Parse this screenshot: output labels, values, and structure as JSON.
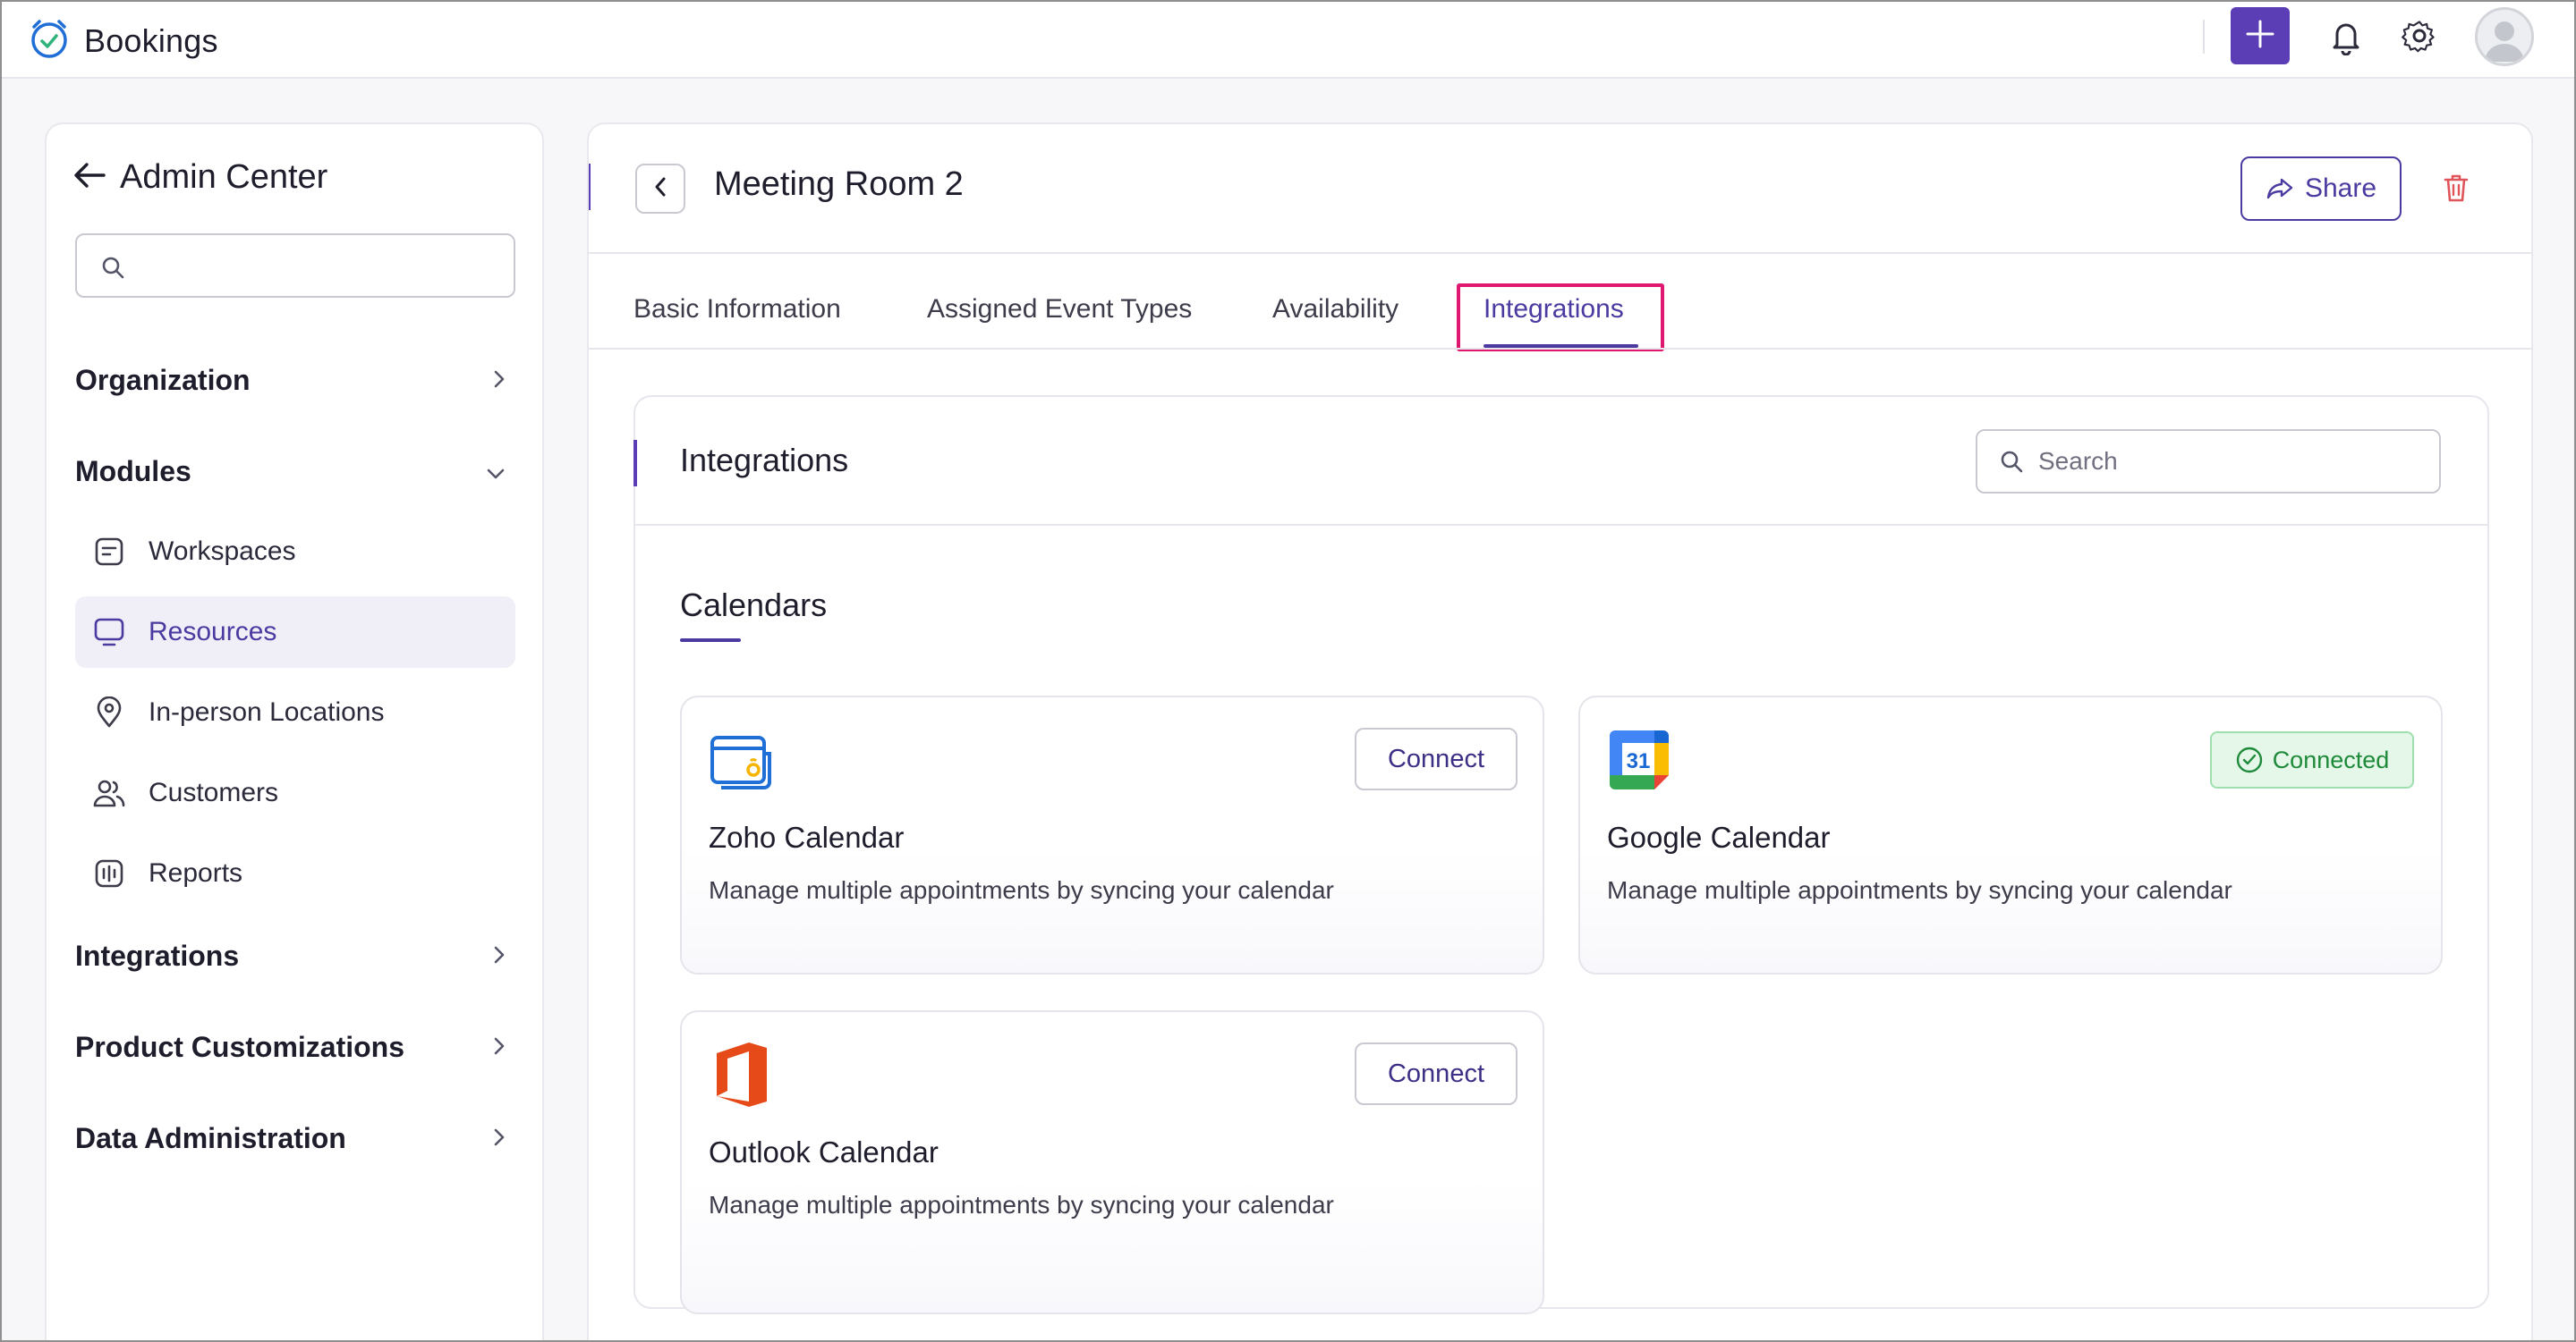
{
  "app": {
    "title": "Bookings",
    "icons": [
      "bookings-logo-icon",
      "plus-icon",
      "bell-icon",
      "gear-icon",
      "avatar"
    ]
  },
  "sidebar": {
    "title": "Admin Center",
    "search_placeholder": "",
    "sections": [
      {
        "label": "Organization",
        "state": "collapsed"
      },
      {
        "label": "Modules",
        "state": "expanded"
      },
      {
        "label": "Integrations",
        "state": "collapsed"
      },
      {
        "label": "Product Customizations",
        "state": "collapsed"
      },
      {
        "label": "Data Administration",
        "state": "collapsed"
      }
    ],
    "module_items": [
      {
        "label": "Workspaces",
        "icon": "workspace-icon"
      },
      {
        "label": "Resources",
        "icon": "monitor-icon",
        "active": true
      },
      {
        "label": "In-person Locations",
        "icon": "location-pin-icon"
      },
      {
        "label": "Customers",
        "icon": "users-icon"
      },
      {
        "label": "Reports",
        "icon": "reports-icon"
      }
    ]
  },
  "main": {
    "title": "Meeting Room 2",
    "share_label": "Share",
    "tabs": [
      {
        "label": "Basic Information"
      },
      {
        "label": "Assigned Event Types"
      },
      {
        "label": "Availability"
      },
      {
        "label": "Integrations",
        "active": true
      }
    ],
    "integrations": {
      "title": "Integrations",
      "search_placeholder": "Search",
      "category": "Calendars",
      "cards": [
        {
          "name": "Zoho Calendar",
          "description": "Manage multiple appointments by syncing your calendar",
          "action": "Connect",
          "status": "not-connected",
          "icon": "zoho-calendar-icon"
        },
        {
          "name": "Google Calendar",
          "description": "Manage multiple appointments by syncing your calendar",
          "action": "Connected",
          "status": "connected",
          "icon": "google-calendar-icon",
          "icon_text": "31"
        },
        {
          "name": "Outlook Calendar",
          "description": "Manage multiple appointments by syncing your calendar",
          "action": "Connect",
          "status": "not-connected",
          "icon": "office-icon"
        }
      ]
    }
  },
  "colors": {
    "accent": "#5b3db5",
    "highlight": "#e0176e",
    "connected_bg": "#e4f7e9",
    "connected_text": "#1e8a3a"
  }
}
